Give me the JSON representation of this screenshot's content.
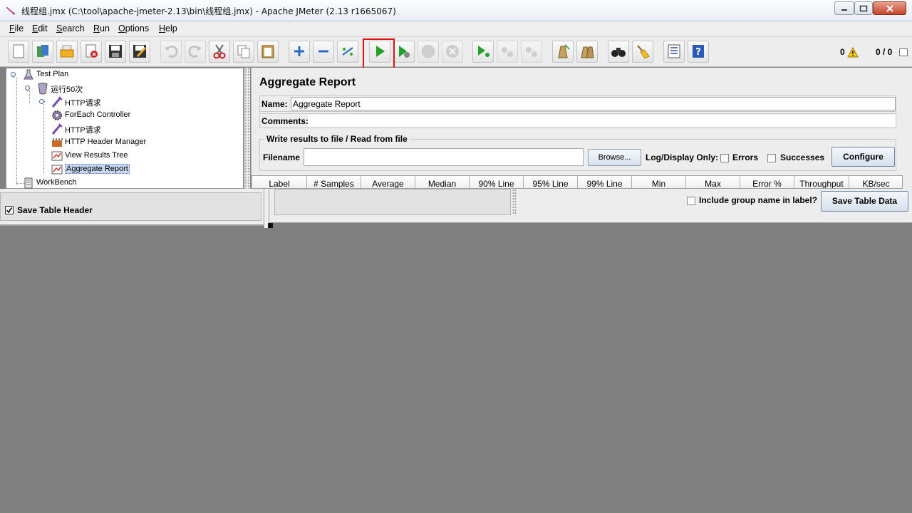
{
  "window": {
    "title": "线程组.jmx (C:\\tool\\apache-jmeter-2.13\\bin\\线程组.jmx) - Apache JMeter (2.13 r1665067)"
  },
  "menu": [
    {
      "label": "File",
      "key": "F",
      "rest": "ile"
    },
    {
      "label": "Edit",
      "key": "E",
      "rest": "dit"
    },
    {
      "label": "Search",
      "key": "S",
      "rest": "earch"
    },
    {
      "label": "Run",
      "key": "R",
      "rest": "un"
    },
    {
      "label": "Options",
      "key": "O",
      "rest": "ptions"
    },
    {
      "label": "Help",
      "key": "H",
      "rest": "elp"
    }
  ],
  "toolbar": {
    "buttons": [
      {
        "name": "new-icon"
      },
      {
        "name": "templates-icon"
      },
      {
        "name": "open-icon"
      },
      {
        "name": "close-icon"
      },
      {
        "name": "save-icon"
      },
      {
        "name": "save-as-icon"
      },
      {
        "name": "undo-icon"
      },
      {
        "name": "redo-icon"
      },
      {
        "name": "cut-icon"
      },
      {
        "name": "copy-icon"
      },
      {
        "name": "paste-icon"
      },
      {
        "name": "expand-icon"
      },
      {
        "name": "collapse-icon"
      },
      {
        "name": "toggle-icon"
      },
      {
        "name": "start-icon"
      },
      {
        "name": "start-no-pauses-icon"
      },
      {
        "name": "stop-icon"
      },
      {
        "name": "shutdown-icon"
      },
      {
        "name": "remote-start-icon"
      },
      {
        "name": "remote-stop-icon"
      },
      {
        "name": "remote-shutdown-icon"
      },
      {
        "name": "clear-icon"
      },
      {
        "name": "clear-all-icon"
      },
      {
        "name": "search-icon"
      },
      {
        "name": "reset-search-icon"
      },
      {
        "name": "function-helper-icon"
      },
      {
        "name": "help-icon"
      }
    ],
    "error_count": "0",
    "thread_count": "0 / 0"
  },
  "tree": {
    "items": [
      {
        "label": "Test Plan",
        "icon": "test-plan-icon"
      },
      {
        "label": "运行50次",
        "icon": "thread-group-icon"
      },
      {
        "label": "HTTP请求",
        "icon": "http-sampler-icon"
      },
      {
        "label": "ForEach Controller",
        "icon": "gear-icon"
      },
      {
        "label": "HTTP请求",
        "icon": "http-sampler-icon"
      },
      {
        "label": "HTTP Header Manager",
        "icon": "header-manager-icon"
      },
      {
        "label": "View Results Tree",
        "icon": "listener-icon"
      },
      {
        "label": "Aggregate Report",
        "icon": "listener-icon"
      },
      {
        "label": "WorkBench",
        "icon": "workbench-icon"
      }
    ]
  },
  "panel": {
    "title": "Aggregate Report",
    "name_label": "Name:",
    "name_value": "Aggregate Report",
    "comments_label": "Comments:",
    "file_group_title": "Write results to file / Read from file",
    "filename_label": "Filename",
    "browse_label": "Browse...",
    "log_display_label": "Log/Display Only:",
    "errors_label": "Errors",
    "successes_label": "Successes",
    "configure_label": "Configure",
    "columns": [
      "Label",
      "# Samples",
      "Average",
      "Median",
      "90% Line",
      "95% Line",
      "99% Line",
      "Min",
      "Max",
      "Error %",
      "Throughput",
      "KB/sec"
    ]
  },
  "bottom": {
    "save_header_label": "Save Table Header",
    "save_header_checked": true,
    "include_group_label": "Include group name in label?",
    "save_data_label": "Save Table Data"
  },
  "colors": {
    "highlight": "#e01010",
    "selection": "#c7d9f2"
  }
}
